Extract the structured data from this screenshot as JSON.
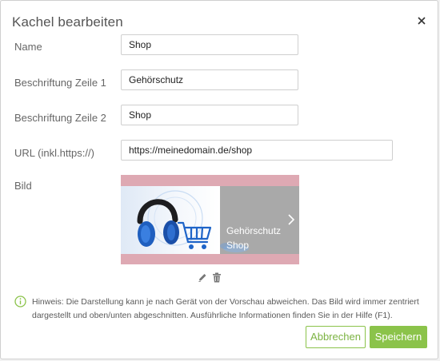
{
  "dialog": {
    "title": "Kachel bearbeiten",
    "close_icon": "close-icon"
  },
  "form": {
    "name_label": "Name",
    "name_value": "Shop",
    "line1_label": "Beschriftung Zeile 1",
    "line1_value": "Gehörschutz",
    "line2_label": "Beschriftung Zeile 2",
    "line2_value": "Shop",
    "url_label": "URL (inkl.https://)",
    "url_value": "https://meinedomain.de/shop",
    "image_label": "Bild"
  },
  "preview": {
    "line1": "Gehörschutz",
    "line2": "Shop",
    "image_description_icon": "headphones-cart-image",
    "chevron_icon": "chevron-right-icon"
  },
  "tools": {
    "edit_icon": "pencil-icon",
    "delete_icon": "trash-icon"
  },
  "hint": {
    "icon": "info-icon",
    "text": "Hinweis: Die Darstellung kann je nach Gerät von der Vorschau abweichen. Das Bild wird immer zentriert dargestellt und oben/unten abgeschnitten. Ausführliche Informationen finden Sie in der Hilfe (F1)."
  },
  "buttons": {
    "cancel": "Abbrechen",
    "save": "Speichern"
  },
  "colors": {
    "accent": "#8bc34a",
    "preview_bg": "#dea9b3",
    "preview_panel": "#a9a9a9"
  }
}
